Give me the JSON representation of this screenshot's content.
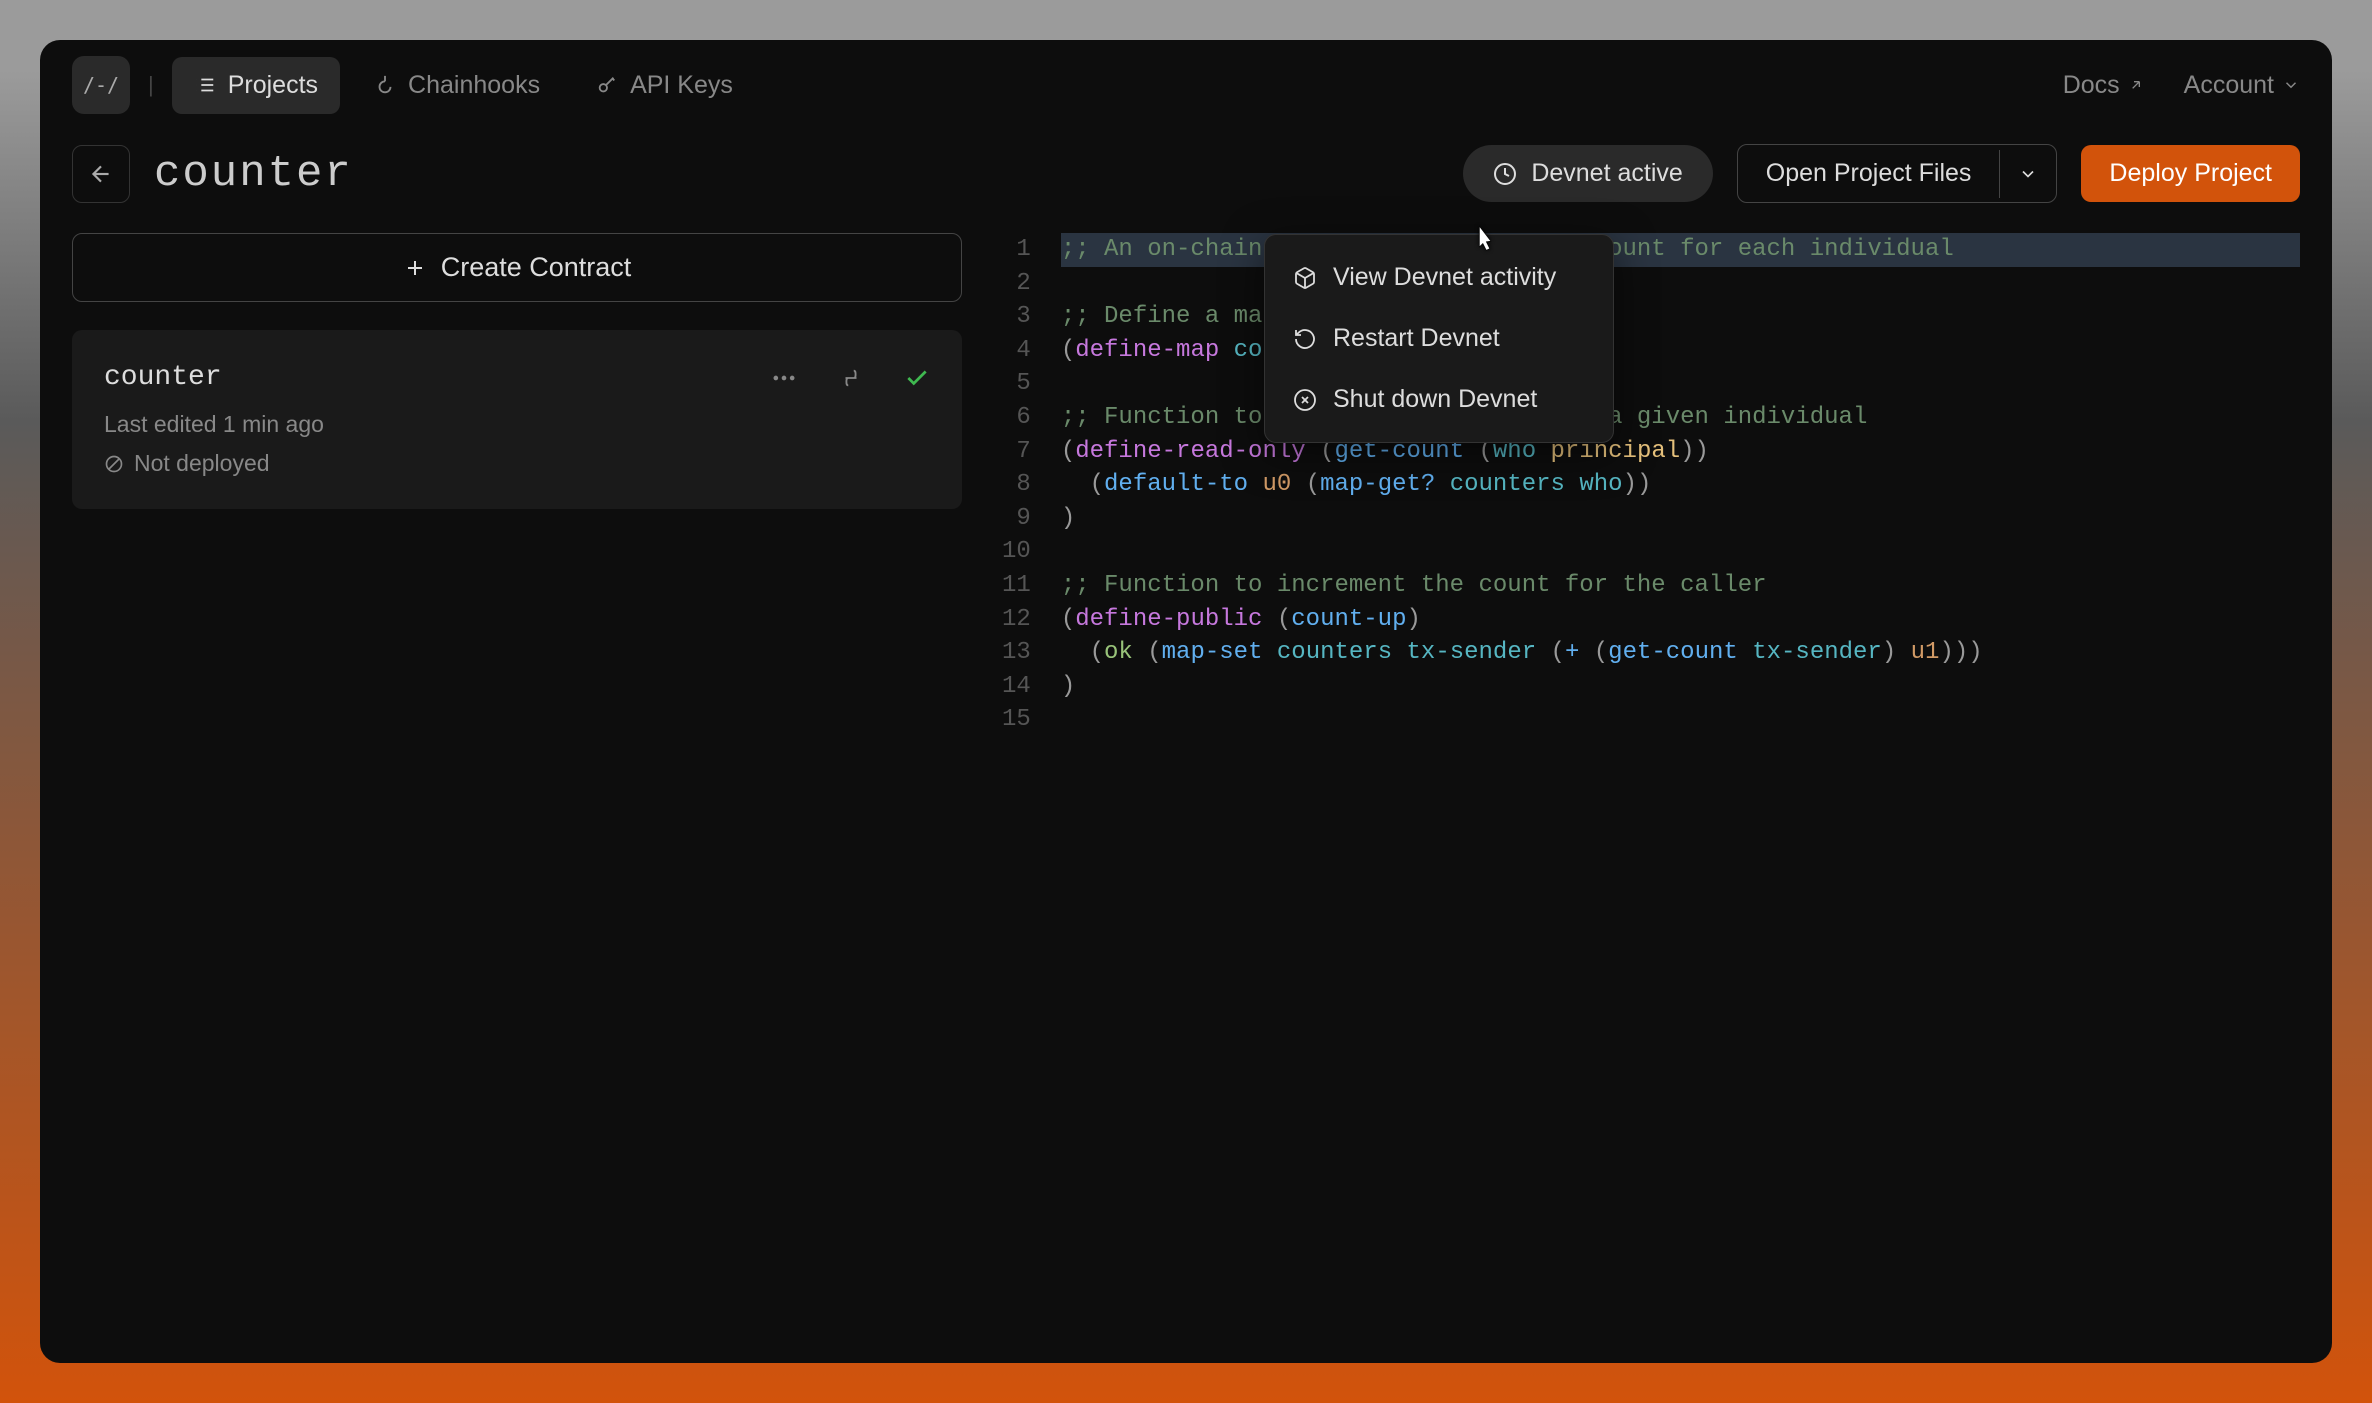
{
  "nav": {
    "logo": "/-/",
    "items": [
      {
        "label": "Projects",
        "active": true
      },
      {
        "label": "Chainhooks",
        "active": false
      },
      {
        "label": "API Keys",
        "active": false
      }
    ],
    "docs": "Docs",
    "account": "Account"
  },
  "project": {
    "title": "counter",
    "devnet_status": "Devnet active",
    "open_files": "Open Project Files",
    "deploy": "Deploy Project"
  },
  "sidebar": {
    "create_contract": "Create Contract",
    "contract": {
      "name": "counter",
      "last_edited": "Last edited 1 min ago",
      "deployment": "Not deployed"
    }
  },
  "dropdown": {
    "items": [
      "View Devnet activity",
      "Restart Devnet",
      "Shut down Devnet"
    ]
  },
  "code": {
    "lines": 15,
    "content": [
      ";; An on-chain counter that stores a count for each individual",
      "",
      ";; Define a map data structure",
      "(define-map counters principal uint)",
      "",
      ";; Function to retrieve the count for a given individual",
      "(define-read-only (get-count (who principal))",
      "  (default-to u0 (map-get? counters who))",
      ")",
      "",
      ";; Function to increment the count for the caller",
      "(define-public (count-up)",
      "  (ok (map-set counters tx-sender (+ (get-count tx-sender) u1)))",
      ")",
      ""
    ]
  }
}
